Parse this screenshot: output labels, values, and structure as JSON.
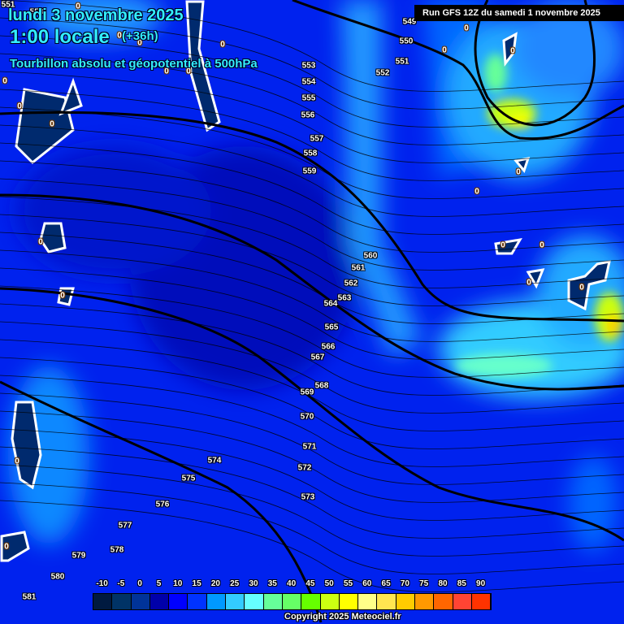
{
  "header": {
    "date": "lundi 3 novembre 2025",
    "time": "1:00 locale",
    "step": "(+36h)",
    "parameter": "Tourbillon absolu et géopotentiel à 500hPa",
    "run": "Run GFS 12Z du samedi 1 novembre 2025"
  },
  "contour_labels": [
    "551",
    "553",
    "549",
    "550",
    "551",
    "552",
    "553",
    "554",
    "555",
    "556",
    "557",
    "558",
    "559",
    "560",
    "561",
    "562",
    "563",
    "564",
    "565",
    "566",
    "567",
    "568",
    "569",
    "570",
    "571",
    "572",
    "573",
    "574",
    "575",
    "576",
    "577",
    "578",
    "579",
    "580",
    "581"
  ],
  "zero_label": "0",
  "legend": {
    "labels": [
      "-10",
      "-5",
      "0",
      "5",
      "10",
      "15",
      "20",
      "25",
      "30",
      "35",
      "40",
      "45",
      "50",
      "55",
      "60",
      "65",
      "70",
      "75",
      "80",
      "85",
      "90"
    ],
    "colors": [
      "#001a40",
      "#003366",
      "#003399",
      "#0000aa",
      "#0000ff",
      "#0033ff",
      "#0099ff",
      "#33ccff",
      "#66ffff",
      "#66ff99",
      "#66ff66",
      "#66ff00",
      "#ccff11",
      "#ffff00",
      "#ffff88",
      "#ffe650",
      "#ffcc00",
      "#ff9900",
      "#ff6600",
      "#ff4433",
      "#ff3300"
    ]
  },
  "copyright": "Copyright 2025 Meteociel.fr"
}
